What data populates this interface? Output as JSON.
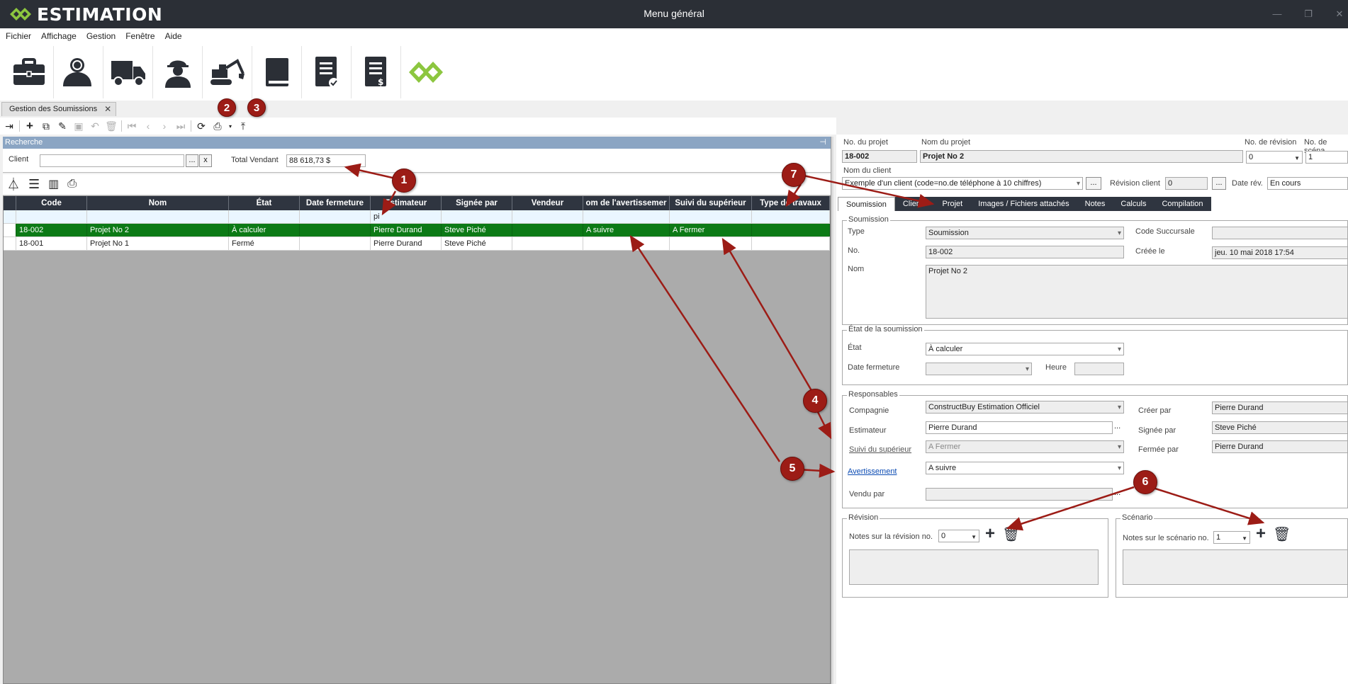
{
  "app": {
    "brand": "ESTIMATION",
    "window_title": "Menu général"
  },
  "menu": [
    "Fichier",
    "Affichage",
    "Gestion",
    "Fenêtre",
    "Aide"
  ],
  "big_toolbar": [
    "briefcase-icon",
    "clients-icon",
    "truck-icon",
    "worker-icon",
    "excavator-icon",
    "book-icon",
    "estimate-doc-icon",
    "invoice-doc-icon",
    "logo-mark-icon"
  ],
  "doc_tab": {
    "label": "Gestion des Soumissions",
    "close": "✕"
  },
  "search": {
    "header": "Recherche",
    "client_label": "Client",
    "client_value": "",
    "browse": "...",
    "clear": "x",
    "total_label": "Total Vendant",
    "total_value": "88 618,73 $"
  },
  "grid": {
    "columns": [
      "Code",
      "Nom",
      "État",
      "Date fermeture",
      "Estimateur",
      "Signée par",
      "Vendeur",
      "om de l'avertissemer",
      "Suivi du supérieur",
      "Type de travaux"
    ],
    "filter_row": [
      "",
      "",
      "",
      "",
      "pi",
      "",
      "",
      "",
      "",
      ""
    ],
    "rows": [
      [
        "18-002",
        "Projet No 2",
        "À calculer",
        "",
        "Pierre Durand",
        "Steve Piché",
        "",
        "A suivre",
        "A Fermer",
        ""
      ],
      [
        "18-001",
        "Projet No 1",
        "Fermé",
        "",
        "Pierre Durand",
        "Steve Piché",
        "",
        "",
        "",
        ""
      ]
    ],
    "selected_row": 0
  },
  "project": {
    "no_label": "No. du projet",
    "no_value": "18-002",
    "name_label": "Nom du projet",
    "name_value": "Projet No 2",
    "revision_label": "No. de révision",
    "revision_value": "0",
    "scenario_label": "No. de scéna",
    "scenario_value": "1",
    "client_label": "Nom du client",
    "client_value": "Exemple d'un client (code=no.de téléphone à 10 chiffres)",
    "client_browse": "...",
    "rev_client_label": "Révision client",
    "rev_client_value": "0",
    "rev_client_browse": "...",
    "date_rev_label": "Date rév.",
    "date_rev_value": "En cours"
  },
  "tabs": [
    "Soumission",
    "Clients",
    "Projet",
    "Images / Fichiers attachés",
    "Notes",
    "Calculs",
    "Compilation"
  ],
  "soumission": {
    "title": "Soumission",
    "type_label": "Type",
    "type_value": "Soumission",
    "code_succ_label": "Code Succursale",
    "code_succ_value": "",
    "no_label": "No.",
    "no_value": "18-002",
    "creee_label": "Créée le",
    "creee_value": "jeu. 10 mai 2018 17:54",
    "nom_label": "Nom",
    "nom_value": "Projet No 2"
  },
  "etat": {
    "title": "État de la soumission",
    "etat_label": "État",
    "etat_value": "À calculer",
    "date_label": "Date fermeture",
    "heure_label": "Heure"
  },
  "responsables": {
    "title": "Responsables",
    "compagnie_label": "Compagnie",
    "compagnie_value": "ConstructBuy Estimation Officiel",
    "creer_label": "Créer par",
    "creer_value": "Pierre Durand",
    "estimateur_label": "Estimateur",
    "estimateur_value": "Pierre Durand",
    "estimateur_browse": "...",
    "signee_label": "Signée par",
    "signee_value": "Steve Piché",
    "suivi_label": "Suivi du supérieur",
    "suivi_value": "A Fermer",
    "fermee_label": "Fermée par",
    "fermee_value": "Pierre Durand",
    "avert_label": "Avertissement",
    "avert_value": "A suivre",
    "vendu_label": "Vendu par",
    "vendu_browse": "..."
  },
  "revision": {
    "title": "Révision",
    "notes_label": "Notes sur la révision no.",
    "value": "0"
  },
  "scenario": {
    "title": "Scénario",
    "notes_label": "Notes sur le scénario no.",
    "value": "1"
  },
  "annotations": [
    "1",
    "2",
    "3",
    "4",
    "5",
    "6",
    "7"
  ],
  "colors": {
    "titlebar": "#2b2f36",
    "grid_header": "#2f3540",
    "selected_row": "#0c7a16",
    "brand_green": "#8cc63f",
    "annotation": "#9c1c16"
  }
}
